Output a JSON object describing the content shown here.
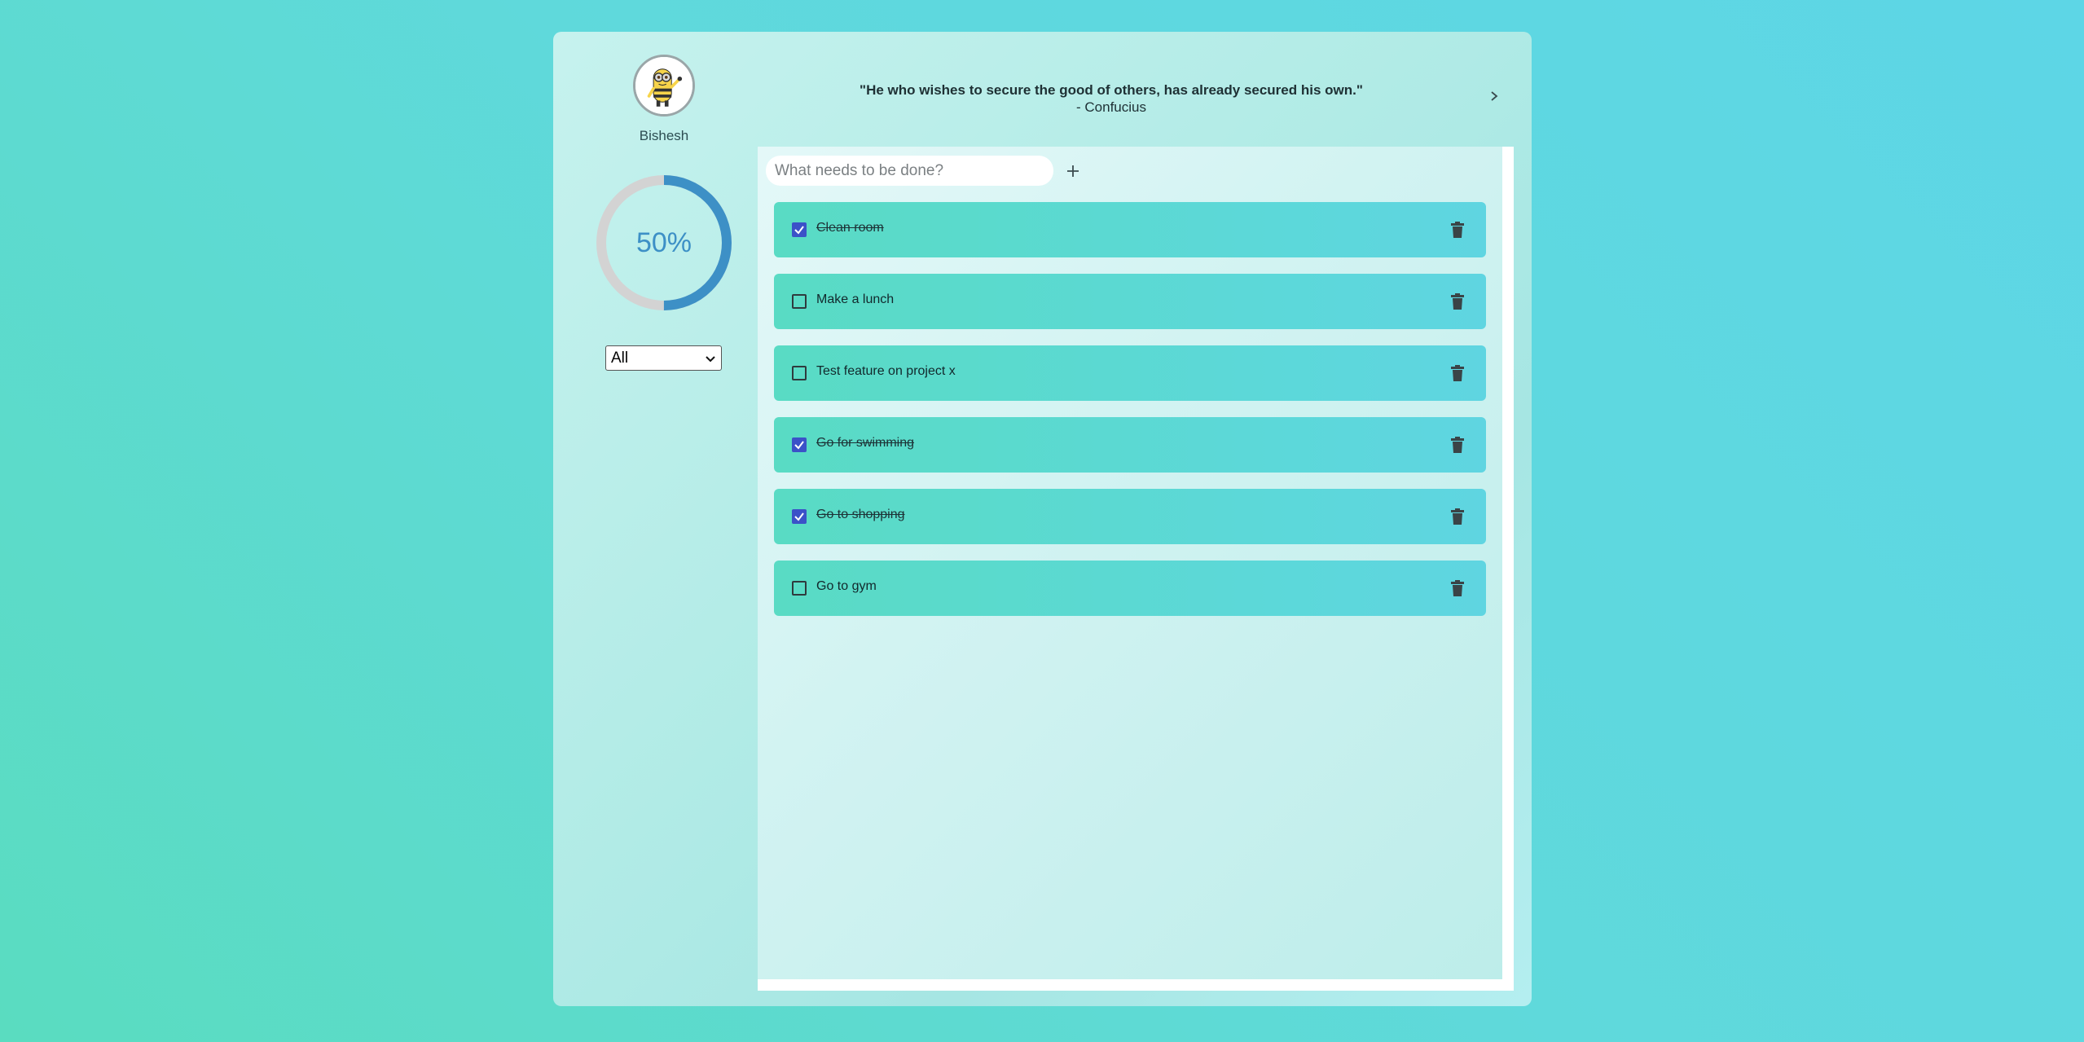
{
  "profile": {
    "name": "Bishesh",
    "avatar_icon": "minion-avatar-icon"
  },
  "progress": {
    "value": 0.5,
    "label": "50%",
    "color": "#3d90c6",
    "track_color": "#d3d3d3"
  },
  "filter": {
    "selected": "All"
  },
  "quote": {
    "text": "\"He who wishes to secure the good of others, has already secured his own.\"",
    "author": "- Confucius",
    "next_icon": "chevron-right-icon"
  },
  "new_task": {
    "placeholder": "What needs to be done?",
    "add_icon": "plus-icon"
  },
  "todos": [
    {
      "label": "Clean room",
      "done": true
    },
    {
      "label": "Make a lunch",
      "done": false
    },
    {
      "label": "Test feature on project x",
      "done": false
    },
    {
      "label": "Go for swimming",
      "done": true
    },
    {
      "label": "Go to shopping",
      "done": true
    },
    {
      "label": "Go to gym",
      "done": false
    }
  ],
  "colors": {
    "checkbox_checked": "#3b52c8",
    "todo_bg": "#5cd8d6",
    "page_bg": "#5dd8d6"
  },
  "icons": {
    "delete": "trash-icon",
    "checkbox": "checkmark-icon"
  }
}
